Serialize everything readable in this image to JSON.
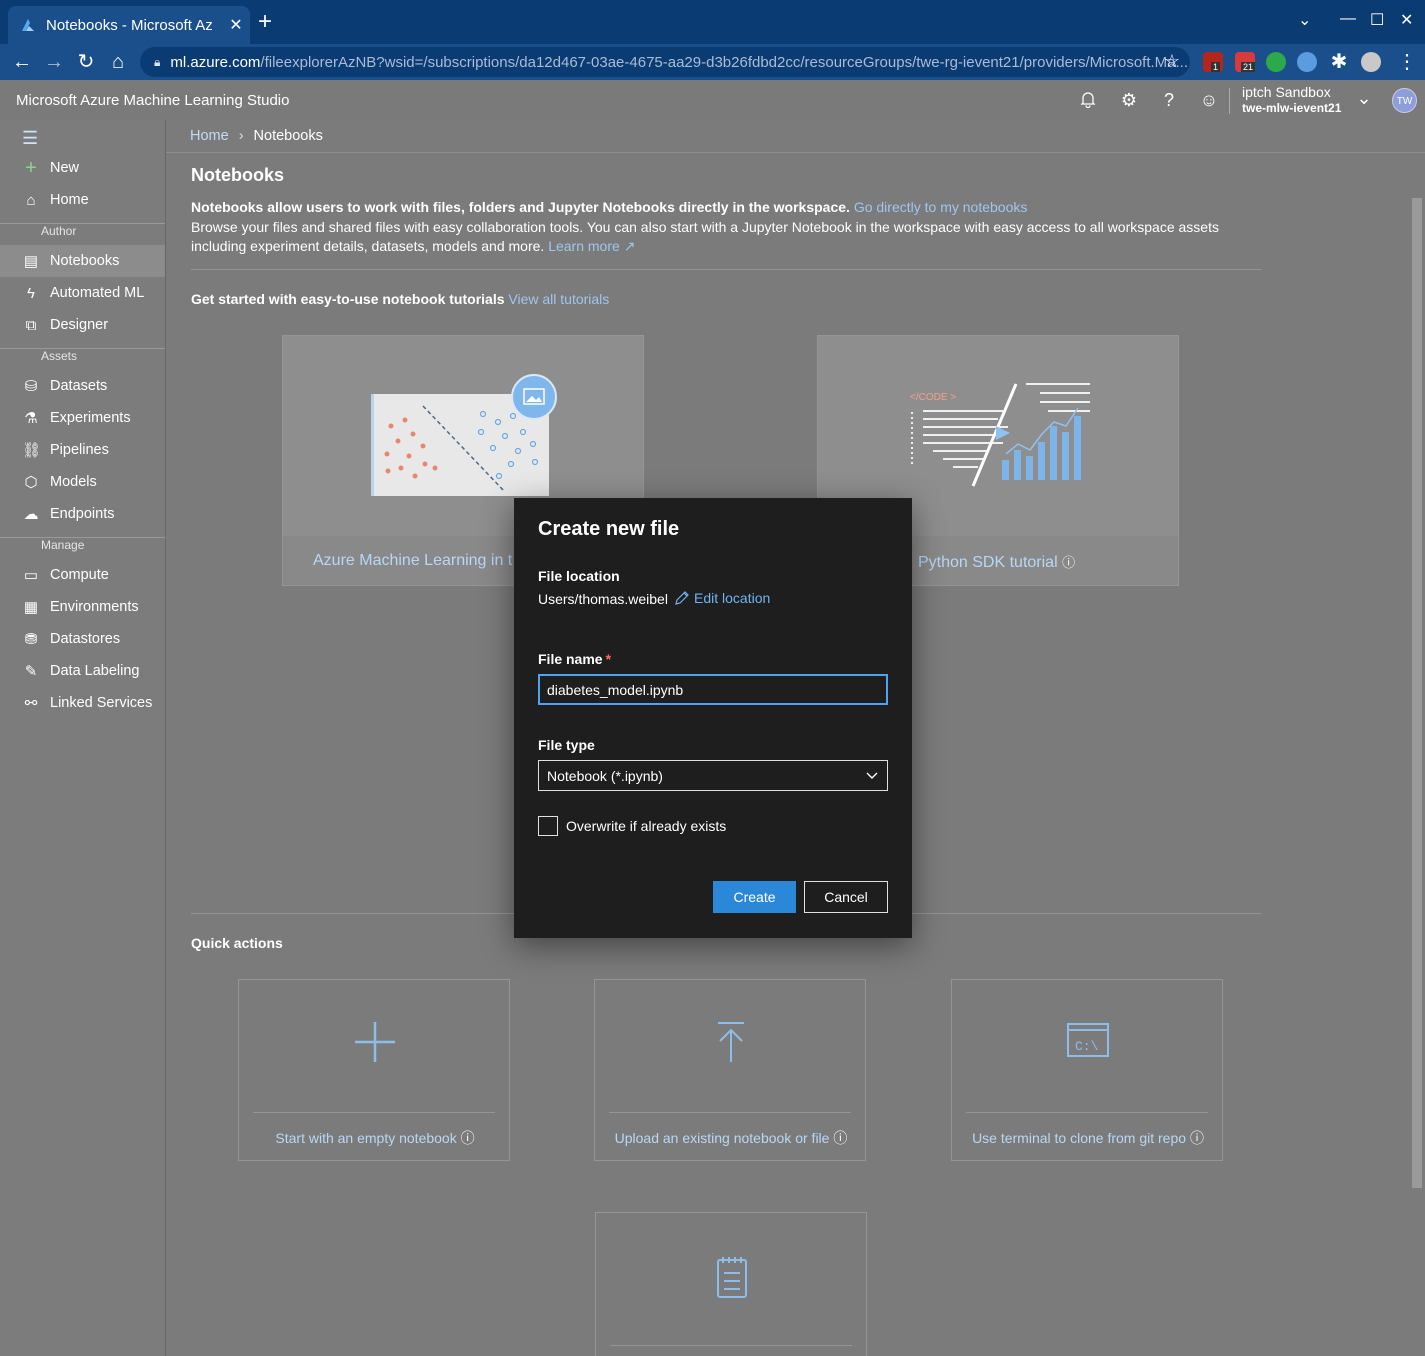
{
  "browser": {
    "tab_title": "Notebooks - Microsoft Az",
    "url_host": "ml.azure.com",
    "url_path": "/fileexplorerAzNB?wsid=/subscriptions/da12d467-03ae-4675-aa29-d3b26fdbd2cc/resourceGroups/twe-rg-ievent21/providers/Microsoft.Ma...",
    "ext_badge_1": "1",
    "ext_badge_2": "21"
  },
  "header": {
    "brand": "Microsoft Azure Machine Learning Studio",
    "account_name": "iptch Sandbox",
    "workspace": "twe-mlw-ievent21",
    "avatar_initials": "TW"
  },
  "nav": {
    "new": "New",
    "home": "Home",
    "section_author": "Author",
    "notebooks": "Notebooks",
    "automated_ml": "Automated ML",
    "designer": "Designer",
    "section_assets": "Assets",
    "datasets": "Datasets",
    "experiments": "Experiments",
    "pipelines": "Pipelines",
    "models": "Models",
    "endpoints": "Endpoints",
    "section_manage": "Manage",
    "compute": "Compute",
    "environments": "Environments",
    "datastores": "Datastores",
    "data_labeling": "Data Labeling",
    "linked_services": "Linked Services"
  },
  "main": {
    "breadcrumb_home": "Home",
    "breadcrumb_current": "Notebooks",
    "title": "Notebooks",
    "intro_bold": "Notebooks allow users to work with files, folders and Jupyter Notebooks directly in the workspace.",
    "intro_link": "Go directly to my notebooks",
    "intro_text": "Browse your files and shared files with easy collaboration tools. You can also start with a Jupyter Notebook in the workspace with easy access to all workspace assets including experiment details, datasets, models and more.",
    "learn_more": "Learn more",
    "tutorials_heading": "Get started with easy-to-use notebook tutorials",
    "view_all_tutorials": "View all tutorials",
    "tutorial_1": "Azure Machine Learning in t",
    "tutorial_2": "Python SDK tutorial",
    "code_tag": "</CODE >",
    "quick_actions": "Quick actions",
    "qa_empty": "Start with an empty notebook",
    "qa_upload": "Upload an existing notebook or file",
    "qa_terminal": "Use terminal to clone from git repo",
    "terminal_glyph": "C:\\"
  },
  "dialog": {
    "title": "Create new file",
    "file_location_label": "File location",
    "file_location_value": "Users/thomas.weibel",
    "edit_location": "Edit location",
    "file_name_label": "File name",
    "required_mark": "*",
    "file_name_value": "diabetes_model.ipynb",
    "file_type_label": "File type",
    "file_type_value": "Notebook (*.ipynb)",
    "overwrite_label": "Overwrite if already exists",
    "create_button": "Create",
    "cancel_button": "Cancel"
  },
  "colors": {
    "accent": "#2b88d8",
    "link": "#6fb3f2",
    "dialog_bg": "#1e1e1e",
    "browser_frame": "#1a4f8c"
  }
}
